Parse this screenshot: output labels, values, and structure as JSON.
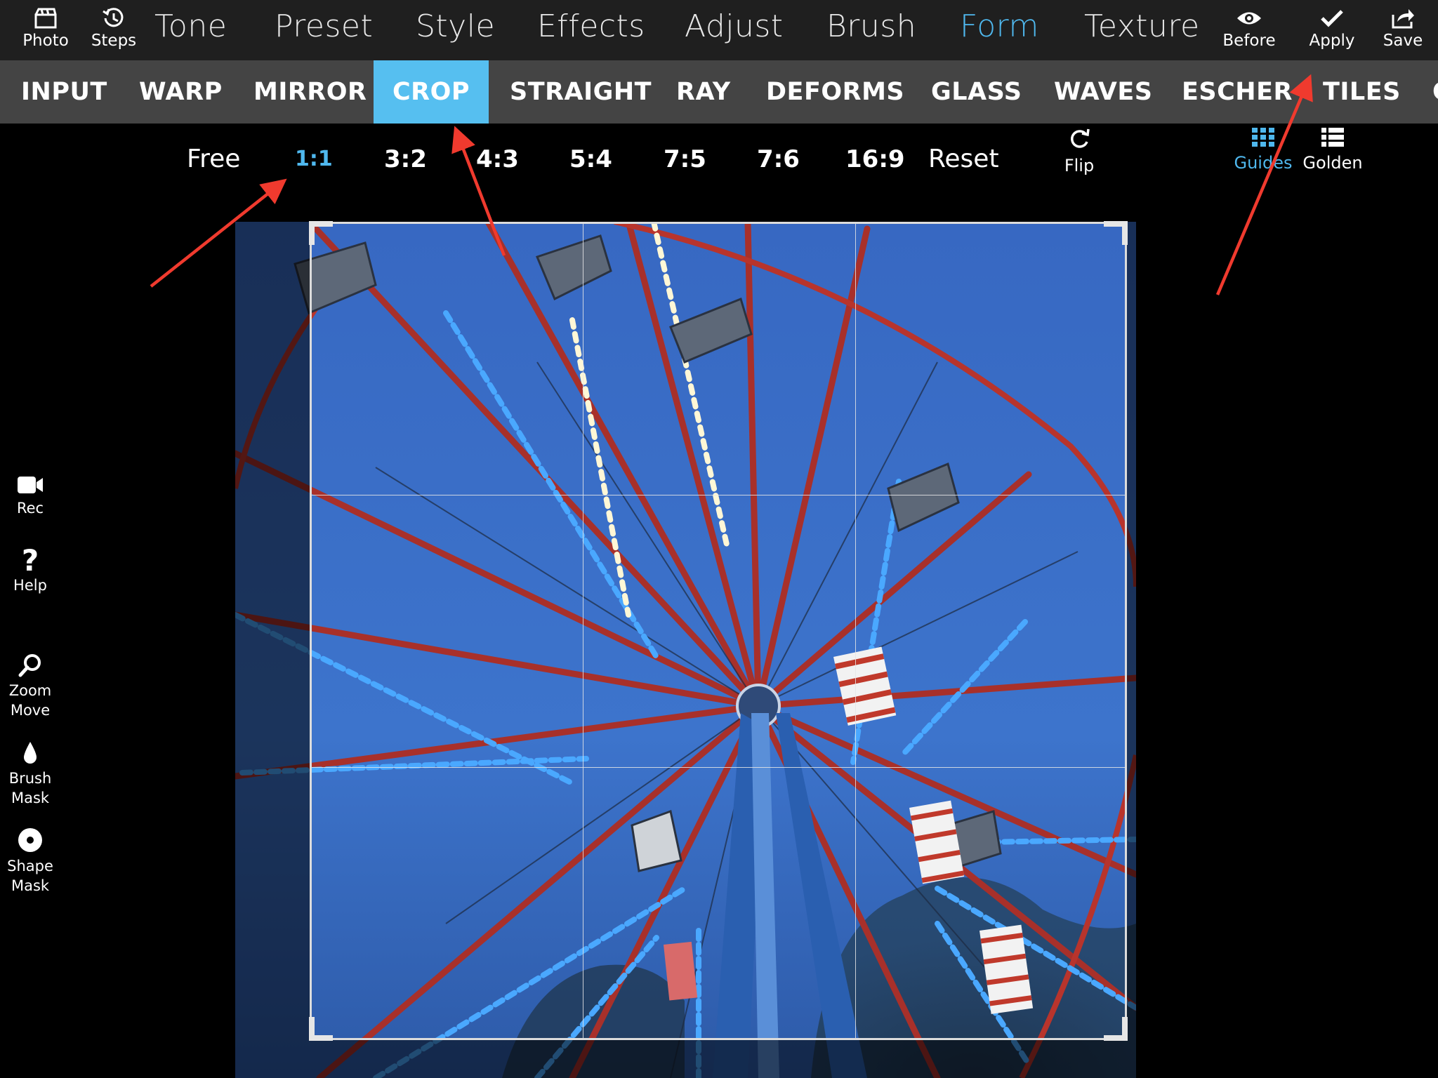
{
  "toolbar": {
    "photo_label": "Photo",
    "steps_label": "Steps",
    "before_label": "Before",
    "apply_label": "Apply",
    "save_label": "Save"
  },
  "menu": {
    "items": [
      "Tone",
      "Preset",
      "Style",
      "Effects",
      "Adjust",
      "Brush",
      "Form",
      "Texture"
    ],
    "active": "Form"
  },
  "form_tabs": {
    "items": [
      "INPUT",
      "WARP",
      "MIRROR",
      "CROP",
      "STRAIGHT",
      "RAY",
      "DEFORMS",
      "GLASS",
      "WAVES",
      "ESCHER",
      "TILES",
      "C"
    ],
    "active": "CROP"
  },
  "crop_options": {
    "ratios": [
      "Free",
      "1:1",
      "3:2",
      "4:3",
      "5:4",
      "7:5",
      "7:6",
      "16:9",
      "Reset"
    ],
    "active": "1:1",
    "flip_label": "Flip",
    "guides_label": "Guides",
    "golden_label": "Golden"
  },
  "side_tools": {
    "rec_label": "Rec",
    "help_label": "Help",
    "zoom_label_1": "Zoom",
    "zoom_label_2": "Move",
    "brush_label_1": "Brush",
    "brush_label_2": "Mask",
    "shape_label_1": "Shape",
    "shape_label_2": "Mask"
  },
  "colors": {
    "accent": "#4fb8ee",
    "active_tab_bg": "#56bff0",
    "annotation_arrow": "#f03a2e",
    "sky": "#3a6fc4",
    "frame_red": "#b8342c",
    "led_blue": "#4aa8ff"
  },
  "icons": {
    "photo": "photo-clapper-icon",
    "steps": "history-icon",
    "before": "eye-icon",
    "apply": "checkmark-icon",
    "save": "share-icon",
    "flip": "rotate-icon",
    "guides": "grid-icon",
    "golden": "list-icon",
    "rec": "video-camera-icon",
    "help": "question-icon",
    "zoom": "magnifier-icon",
    "brush": "drop-icon",
    "shape": "target-icon"
  }
}
